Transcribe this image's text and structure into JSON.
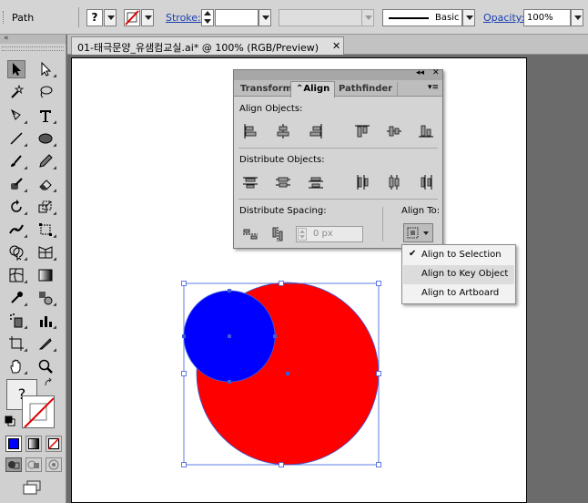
{
  "control_bar": {
    "object_type": "Path",
    "fill_swatch_glyph": "?",
    "stroke_label": "Stroke:",
    "brush_label": "Basic",
    "opacity_label": "Opacity:",
    "opacity_value": "100%"
  },
  "document": {
    "tab_title": "01-태극문양_유샘컴교실.ai* @ 100% (RGB/Preview)",
    "close_glyph": "✕"
  },
  "tools": {
    "collapse_glyph": "«",
    "fill_swatch_glyph": "?"
  },
  "align_panel": {
    "collapse_glyph": "◂◂",
    "close_glyph": "✕",
    "tabs": [
      {
        "label": "Transform"
      },
      {
        "label": "⌃Align"
      },
      {
        "label": "Pathfinder"
      }
    ],
    "menu_glyph": "▾≡",
    "align_objects_label": "Align Objects:",
    "distribute_objects_label": "Distribute Objects:",
    "distribute_spacing_label": "Distribute Spacing:",
    "align_to_label": "Align To:",
    "spacing_value": "0 px"
  },
  "align_to_menu": {
    "items": [
      {
        "label": "Align to Selection",
        "checked": true
      },
      {
        "label": "Align to Key Object",
        "checked": false
      },
      {
        "label": "Align to Artboard",
        "checked": false
      }
    ],
    "check_glyph": "✔"
  },
  "colors": {
    "big_circle_fill": "#ff0000",
    "small_circle_fill": "#0000ff",
    "selection_color": "#3b5bdb"
  }
}
